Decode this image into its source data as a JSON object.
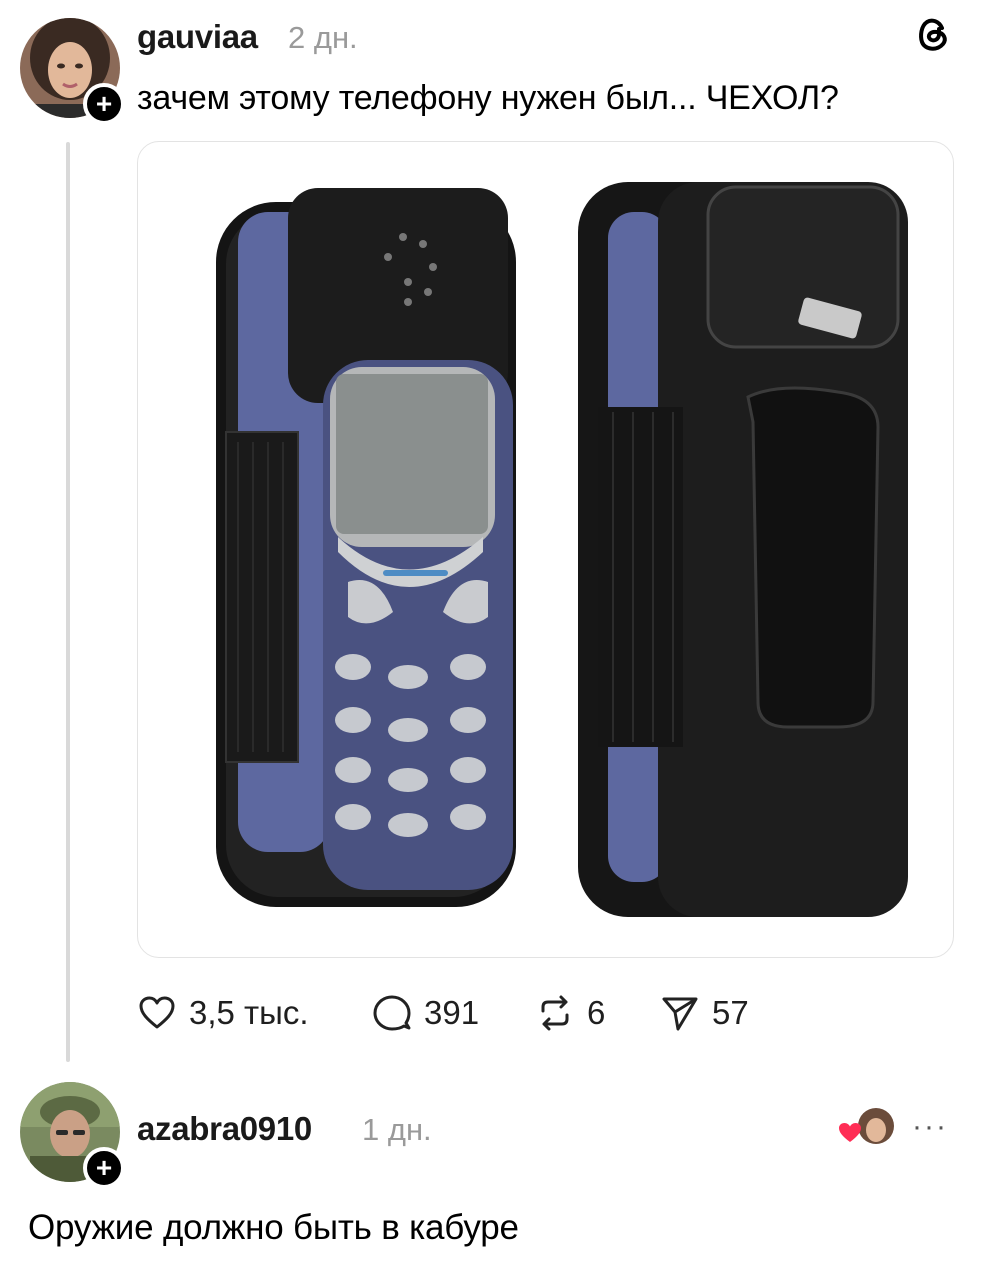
{
  "post": {
    "username": "gauviaa",
    "time": "2 дн.",
    "text": "зачем этому телефону нужен был... ЧЕХОЛ?",
    "stats": {
      "likes": "3,5 тыс.",
      "replies": "391",
      "reposts": "6",
      "shares": "57"
    }
  },
  "reply": {
    "username": "azabra0910",
    "time": "1 дн.",
    "text": "Оружие должно быть в кабуре",
    "more_label": "···"
  },
  "icons": {
    "app_logo": "threads-logo-icon",
    "follow": "plus-icon",
    "like": "heart-icon",
    "reply": "speech-bubble-icon",
    "repost": "repost-icon",
    "share": "send-icon",
    "liked_by_author": "heart-badge-icon"
  },
  "colors": {
    "text": "#000000",
    "muted": "#9a9a9a",
    "accent_heart": "#ff2d55",
    "phone_blue": "#5a6596",
    "case_black": "#1c1c1c"
  }
}
